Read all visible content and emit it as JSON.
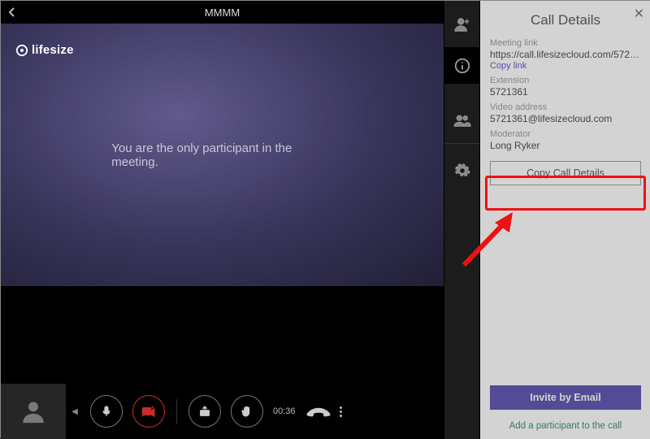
{
  "header": {
    "title": "MMMM"
  },
  "logo": {
    "text": "lifesize"
  },
  "video": {
    "message": "You are the only participant in the meeting."
  },
  "call": {
    "elapsed": "00:36"
  },
  "panel": {
    "title": "Call Details",
    "meeting_link_label": "Meeting link",
    "meeting_link_value": "https://call.lifesizecloud.com/57213...",
    "copy_link": "Copy link",
    "extension_label": "Extension",
    "extension_value": "5721361",
    "video_addr_label": "Video address",
    "video_addr_value": "5721361@lifesizecloud.com",
    "moderator_label": "Moderator",
    "moderator_value": "Long Ryker",
    "copy_button": "Copy Call Details",
    "invite_button": "Invite by Email",
    "add_participant": "Add a participant to the call"
  }
}
